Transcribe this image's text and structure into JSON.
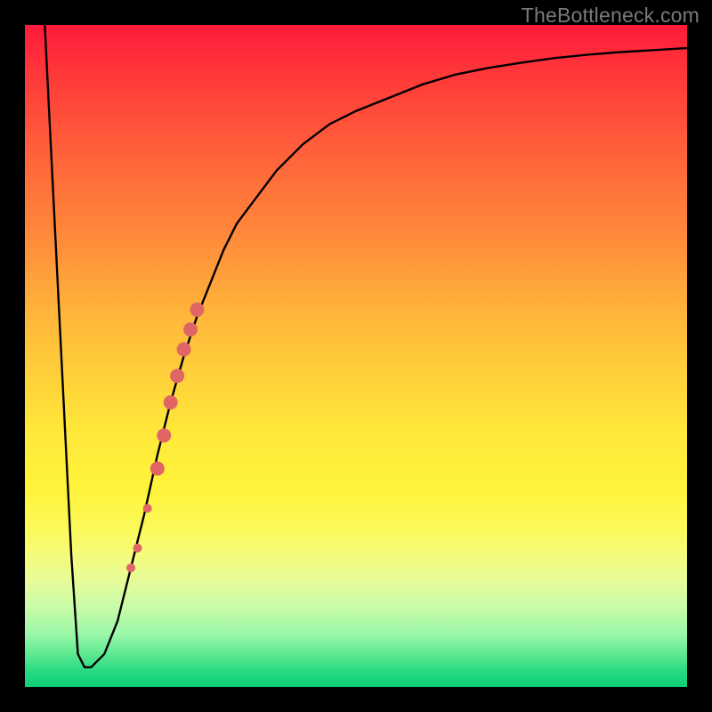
{
  "watermark": "TheBottleneck.com",
  "colors": {
    "frame": "#000000",
    "curve": "#000000",
    "dot": "#e06666",
    "gradient_top": "#ff1a3a",
    "gradient_bottom": "#0ecf74"
  },
  "chart_data": {
    "type": "line",
    "title": "",
    "xlabel": "",
    "ylabel": "",
    "xlim": [
      0,
      100
    ],
    "ylim": [
      0,
      100
    ],
    "grid": false,
    "series": [
      {
        "name": "bottleneck-curve",
        "x": [
          3,
          4,
          5,
          6,
          7,
          8,
          9,
          10,
          12,
          14,
          16,
          18,
          20,
          22,
          24,
          26,
          28,
          30,
          32,
          35,
          38,
          42,
          46,
          50,
          55,
          60,
          65,
          70,
          75,
          80,
          85,
          90,
          95,
          100
        ],
        "y": [
          100,
          80,
          60,
          40,
          20,
          5,
          3,
          3,
          5,
          10,
          18,
          26,
          35,
          43,
          50,
          56,
          61,
          66,
          70,
          74,
          78,
          82,
          85,
          87,
          89,
          91,
          92.5,
          93.5,
          94.3,
          95,
          95.5,
          95.9,
          96.2,
          96.5
        ]
      }
    ],
    "markers": [
      {
        "x": 16,
        "y": 18,
        "r": 5
      },
      {
        "x": 17,
        "y": 21,
        "r": 5
      },
      {
        "x": 18.5,
        "y": 27,
        "r": 5
      },
      {
        "x": 20,
        "y": 33,
        "r": 8
      },
      {
        "x": 21,
        "y": 38,
        "r": 8
      },
      {
        "x": 22,
        "y": 43,
        "r": 8
      },
      {
        "x": 23,
        "y": 47,
        "r": 8
      },
      {
        "x": 24,
        "y": 51,
        "r": 8
      },
      {
        "x": 25,
        "y": 54,
        "r": 8
      },
      {
        "x": 26,
        "y": 57,
        "r": 8
      }
    ]
  }
}
